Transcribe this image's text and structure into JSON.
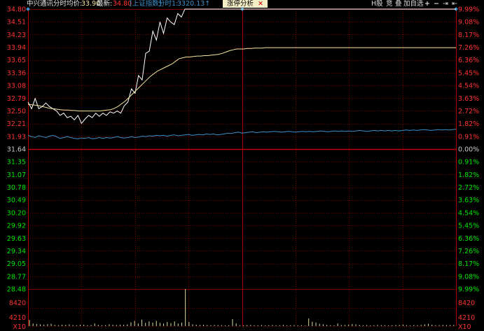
{
  "header": {
    "stock_name": "中兴通讯",
    "mode": "分时",
    "avg_label": "均价:",
    "avg_value": "33.90",
    "last_label": "最新:",
    "last_value": "34.80",
    "index_label": "[上证指数]",
    "index_mode": "分时1:",
    "index_value": "3320.13↑",
    "tip_label": "涨停分析",
    "tip_close": "✕",
    "buttons": [
      "H股",
      "竞",
      "叠",
      "加自选",
      "+",
      "−",
      "⇥",
      "⇤"
    ]
  },
  "price_axis": {
    "left_labels": [
      "34.80",
      "34.51",
      "34.23",
      "33.94",
      "33.65",
      "33.36",
      "33.08",
      "32.79",
      "32.50",
      "32.21",
      "31.93",
      "31.64",
      "31.35",
      "31.07",
      "30.78",
      "30.49",
      "30.20",
      "29.92",
      "29.63",
      "29.34",
      "29.05",
      "28.77",
      "28.48"
    ],
    "right_labels": [
      "9.99%",
      "9.08%",
      "8.17%",
      "7.26%",
      "6.36%",
      "5.45%",
      "4.54%",
      "3.63%",
      "2.72%",
      "1.82%",
      "0.91%",
      "0.00%",
      "0.91%",
      "1.82%",
      "2.72%",
      "3.63%",
      "4.54%",
      "5.45%",
      "6.36%",
      "7.26%",
      "8.17%",
      "9.08%",
      "9.99%"
    ]
  },
  "volume_axis": {
    "labels": [
      "8420",
      "4210",
      "X10"
    ]
  },
  "colors": {
    "up": "#ff3232",
    "down": "#00e600",
    "flat": "#cccccc",
    "grid": "#7a0000",
    "price_line": "#ffffff",
    "avg_line": "#f5e6a0",
    "index_line": "#3c90c8",
    "volume": "#d9d9a0"
  },
  "chart_data": {
    "type": "line",
    "prev_close": 31.64,
    "limit_up": 34.8,
    "limit_down": 28.48,
    "ylim": [
      28.48,
      34.8
    ],
    "series": [
      {
        "values": [
          32.7,
          32.55,
          32.78,
          32.55,
          32.6,
          32.68,
          32.6,
          32.55,
          32.5,
          32.4,
          32.45,
          32.35,
          32.38,
          32.3,
          32.4,
          32.22,
          32.32,
          32.4,
          32.35,
          32.45,
          32.38,
          32.45,
          32.4,
          32.48,
          32.45,
          32.5,
          32.45,
          32.62,
          32.7,
          33.0,
          32.9,
          33.3,
          33.2,
          33.8,
          33.85,
          34.3,
          34.1,
          34.51,
          34.25,
          34.6,
          34.51,
          34.45,
          34.7,
          34.62,
          34.8,
          34.8,
          34.8,
          34.8,
          34.8,
          34.8,
          34.8,
          34.8,
          34.8,
          34.8,
          34.8,
          34.8,
          34.8,
          34.8,
          34.8,
          34.8,
          34.8,
          34.8,
          34.8,
          34.8,
          34.8,
          34.8,
          34.8,
          34.8,
          34.8,
          34.8,
          34.8,
          34.8,
          34.8,
          34.8,
          34.8,
          34.8,
          34.8,
          34.8,
          34.8,
          34.8,
          34.8,
          34.8,
          34.8,
          34.8,
          34.8,
          34.8,
          34.8,
          34.8,
          34.8,
          34.8,
          34.8,
          34.8,
          34.8,
          34.8,
          34.8,
          34.8,
          34.8,
          34.8,
          34.8,
          34.8,
          34.8,
          34.8,
          34.8,
          34.8,
          34.8,
          34.8,
          34.8,
          34.8,
          34.8,
          34.8,
          34.8,
          34.8,
          34.8,
          34.8,
          34.8,
          34.8,
          34.8,
          34.8,
          34.8,
          34.8,
          34.8
        ]
      },
      {
        "values": [
          32.65,
          32.64,
          32.63,
          32.62,
          32.6,
          32.58,
          32.56,
          32.55,
          32.54,
          32.53,
          32.52,
          32.52,
          32.51,
          32.51,
          32.5,
          32.5,
          32.5,
          32.5,
          32.5,
          32.5,
          32.5,
          32.51,
          32.52,
          32.53,
          32.56,
          32.6,
          32.66,
          32.72,
          32.8,
          32.88,
          32.96,
          33.04,
          33.12,
          33.2,
          33.28,
          33.34,
          33.4,
          33.44,
          33.48,
          33.52,
          33.56,
          33.62,
          33.68,
          33.7,
          33.72,
          33.72,
          33.73,
          33.74,
          33.74,
          33.75,
          33.75,
          33.76,
          33.77,
          33.78,
          33.8,
          33.83,
          33.86,
          33.88,
          33.9,
          33.9,
          33.9,
          33.91,
          33.91,
          33.92,
          33.92,
          33.92,
          33.93,
          33.93,
          33.93,
          33.93,
          33.93,
          33.93,
          33.93,
          33.93,
          33.93,
          33.93,
          33.93,
          33.93,
          33.93,
          33.93,
          33.93,
          33.93,
          33.93,
          33.93,
          33.93,
          33.93,
          33.93,
          33.93,
          33.93,
          33.93,
          33.93,
          33.93,
          33.93,
          33.93,
          33.93,
          33.93,
          33.93,
          33.93,
          33.93,
          33.93,
          33.93,
          33.93,
          33.93,
          33.93,
          33.93,
          33.93,
          33.93,
          33.93,
          33.93,
          33.93,
          33.93,
          33.93,
          33.93,
          33.93,
          33.93,
          33.93,
          33.93,
          33.93,
          33.93,
          33.93
        ]
      },
      {
        "values": [
          31.95,
          31.92,
          31.9,
          31.94,
          31.92,
          31.9,
          31.93,
          31.95,
          31.92,
          31.88,
          31.9,
          31.92,
          31.9,
          31.88,
          31.87,
          31.89,
          31.88,
          31.9,
          31.87,
          31.88,
          31.9,
          31.88,
          31.9,
          31.89,
          31.9,
          31.92,
          31.9,
          31.89,
          31.9,
          31.92,
          31.9,
          31.91,
          31.93,
          31.92,
          31.94,
          31.93,
          31.95,
          31.94,
          31.95,
          31.93,
          31.95,
          31.96,
          31.94,
          31.95,
          31.96,
          31.97,
          31.95,
          31.96,
          31.97,
          31.96,
          31.98,
          31.97,
          31.98,
          31.96,
          31.97,
          31.98,
          32.0,
          31.99,
          32.01,
          32.02,
          32.0,
          32.01,
          32.02,
          32.03,
          32.01,
          32.02,
          32.03,
          32.02,
          32.03,
          32.04,
          32.03,
          32.02,
          32.03,
          32.04,
          32.03,
          32.02,
          32.03,
          32.04,
          32.03,
          32.04,
          32.03,
          32.04,
          32.05,
          32.04,
          32.03,
          32.04,
          32.05,
          32.04,
          32.05,
          32.04,
          32.05,
          32.04,
          32.05,
          32.06,
          32.05,
          32.04,
          32.05,
          32.06,
          32.05,
          32.06,
          32.05,
          32.06,
          32.05,
          32.06,
          32.05,
          32.06,
          32.07,
          32.06,
          32.07,
          32.06,
          32.07,
          32.08,
          32.07,
          32.06,
          32.07,
          32.08,
          32.07,
          32.08,
          32.07,
          32.08,
          32.09
        ]
      }
    ],
    "volume": {
      "ylim": [
        0,
        12630
      ],
      "values": [
        2100,
        900,
        700,
        600,
        500,
        650,
        800,
        400,
        300,
        500,
        400,
        600,
        350,
        300,
        450,
        500,
        300,
        350,
        900,
        400,
        300,
        350,
        600,
        450,
        380,
        500,
        450,
        600,
        1300,
        1800,
        900,
        2200,
        1100,
        1600,
        1200,
        1800,
        1100,
        900,
        1400,
        1000,
        1600,
        900,
        1200,
        13000,
        1400,
        600,
        500,
        400,
        450,
        350,
        300,
        400,
        350,
        300,
        250,
        300,
        2400,
        900,
        300,
        250,
        350,
        400,
        300,
        250,
        350,
        200,
        300,
        350,
        250,
        300,
        400,
        250,
        300,
        350,
        250,
        300,
        200,
        2600,
        1500,
        1200,
        800,
        600,
        400,
        300,
        250,
        900,
        350,
        400,
        500,
        700,
        600,
        400,
        300,
        350,
        250,
        300,
        400,
        350,
        300,
        250,
        300,
        350,
        400,
        500,
        300,
        250,
        350,
        300,
        400,
        600,
        800,
        500,
        300,
        350,
        400,
        300,
        350,
        400
      ]
    }
  }
}
